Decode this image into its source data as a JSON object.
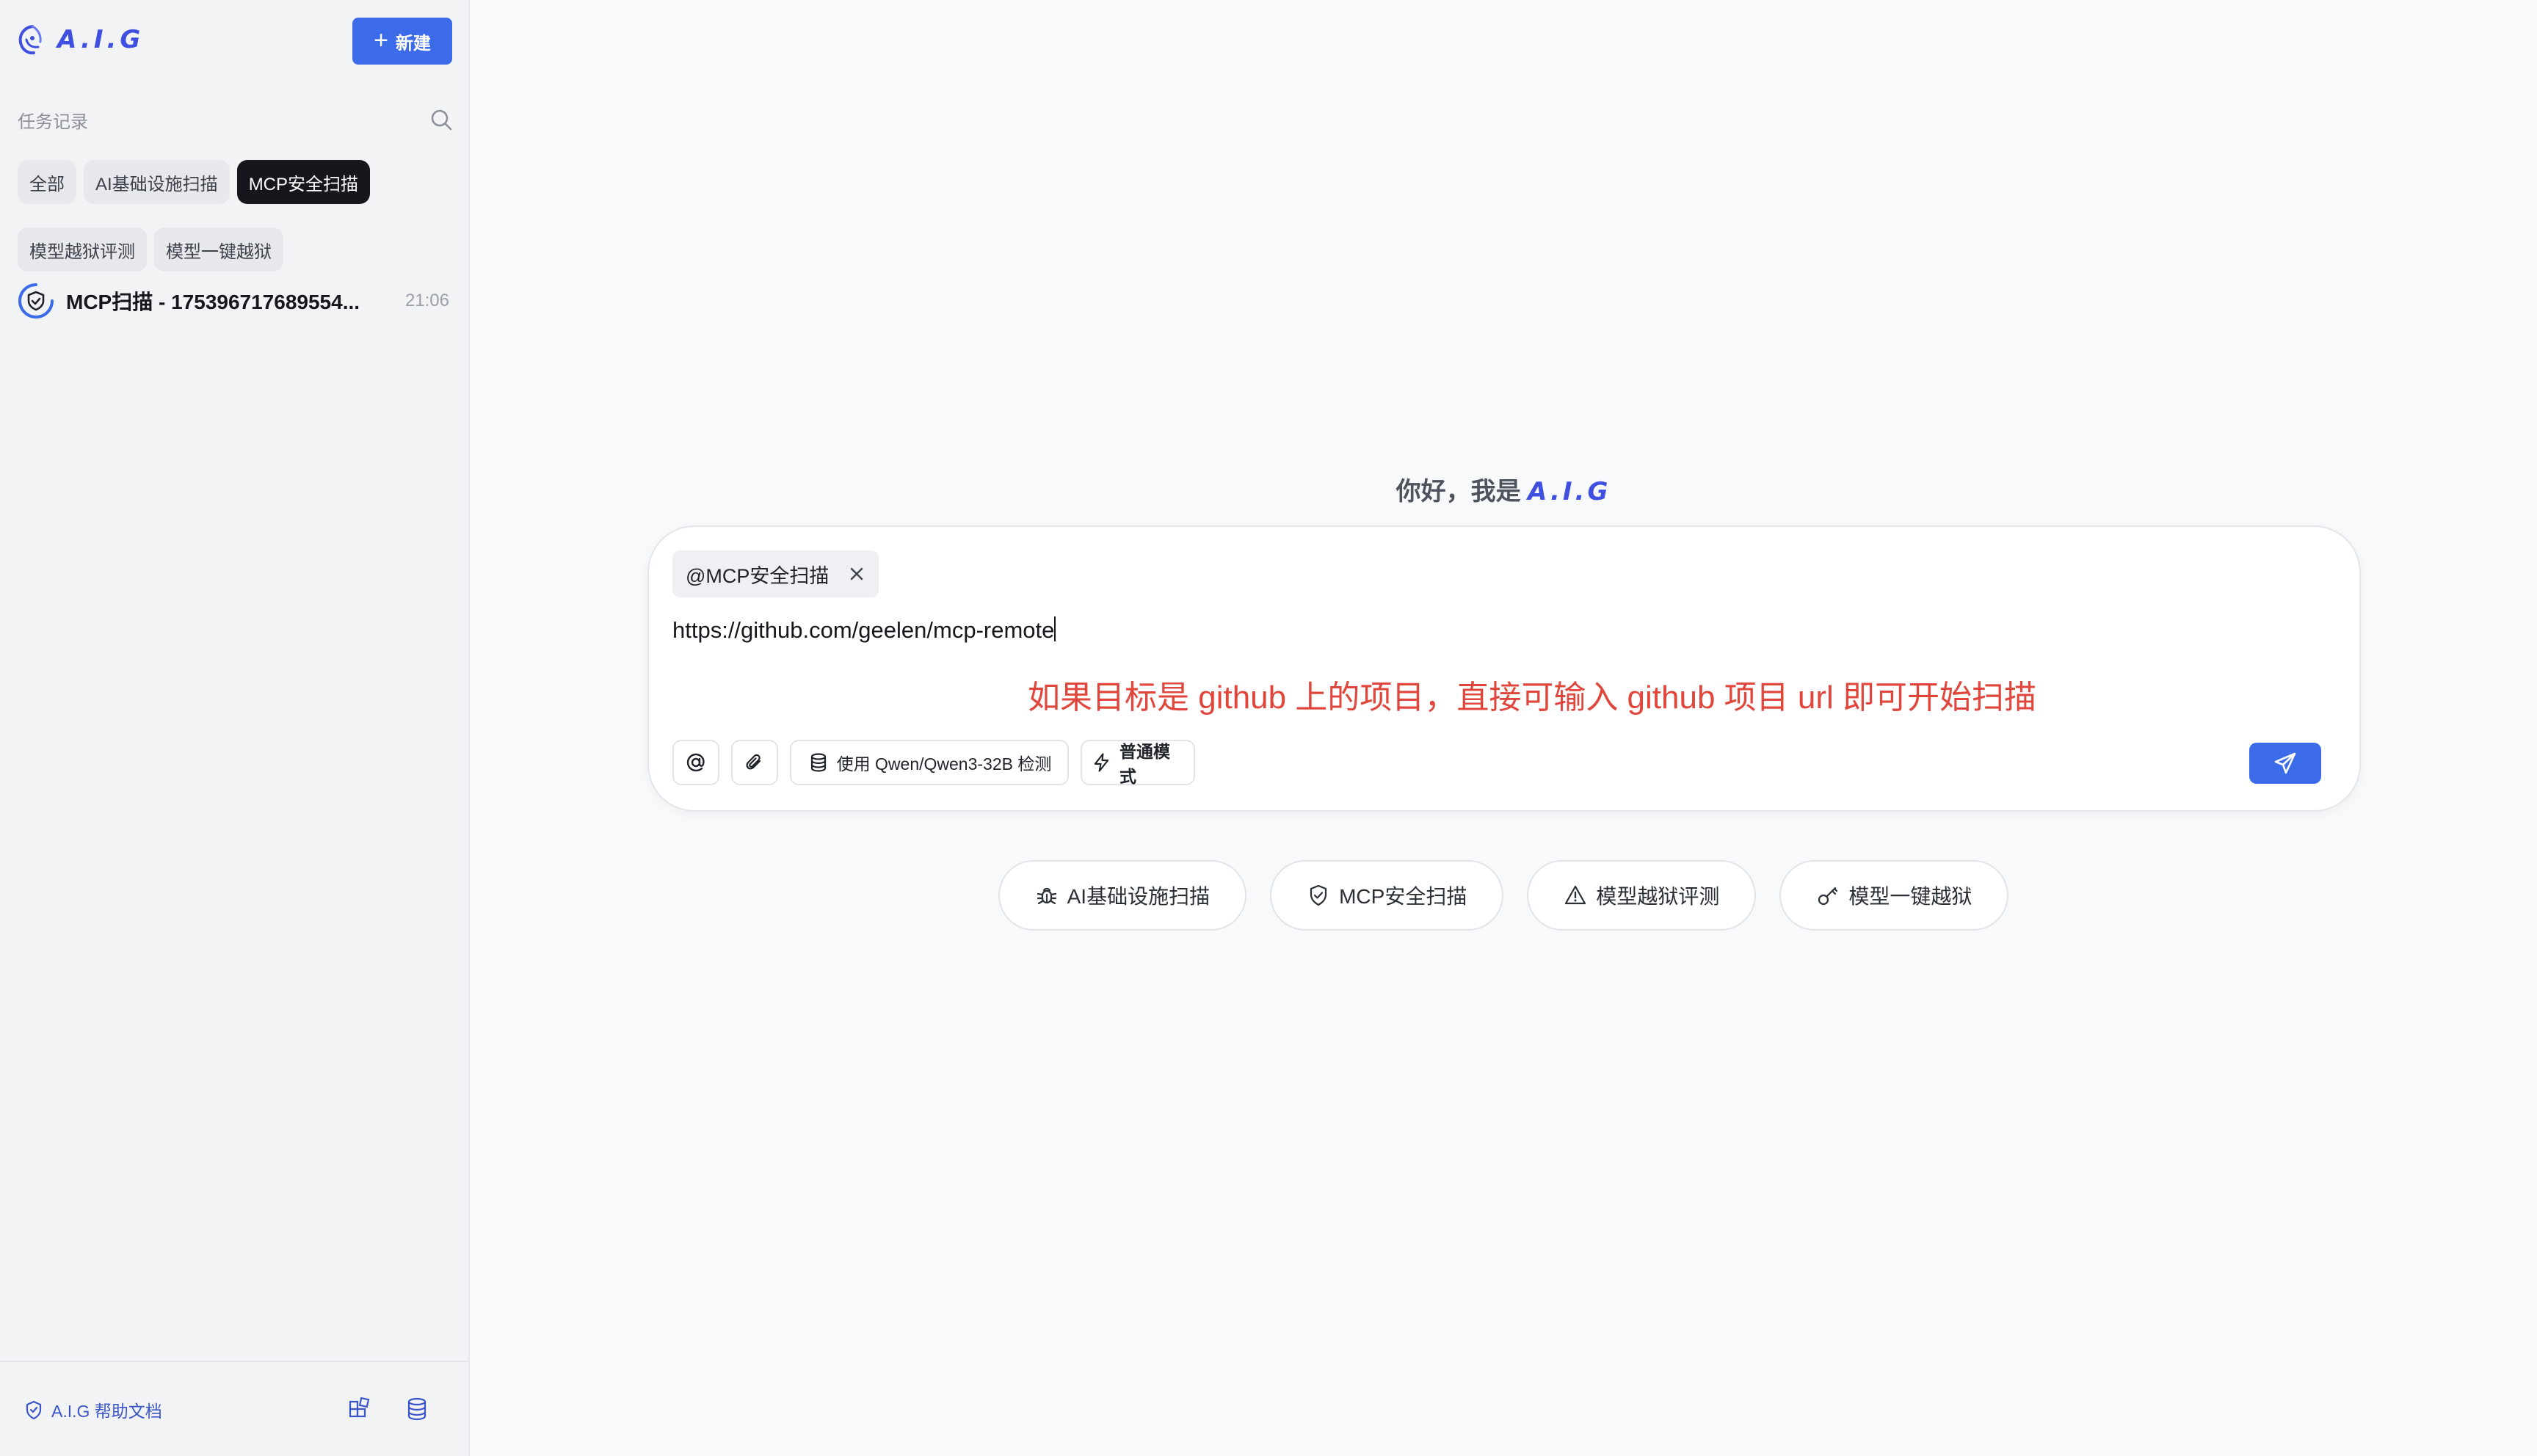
{
  "brand": {
    "name": "A.I.G"
  },
  "sidebar": {
    "new_button": "新建",
    "section_label": "任务记录",
    "filters": [
      "全部",
      "AI基础设施扫描",
      "MCP安全扫描",
      "模型越狱评测",
      "模型一键越狱"
    ],
    "active_filter": "MCP安全扫描",
    "tasks": [
      {
        "title": "MCP扫描 - 175396717689554...",
        "time": "21:06",
        "icon": "shield-check-icon"
      }
    ],
    "footer": {
      "help_link": "A.I.G 帮助文档"
    }
  },
  "main": {
    "greeting_prefix": "你好，我是",
    "greeting_brand": "A.I.G",
    "composer": {
      "mention_tag": "@MCP安全扫描",
      "input_value": "https://github.com/geelen/mcp-remote",
      "hint": "如果目标是 github 上的项目，直接可输入 github 项目 url 即可开始扫描",
      "model_button": "使用 Qwen/Qwen3-32B 检测",
      "mode_button": "普通模式"
    },
    "quick_actions": [
      {
        "label": "AI基础设施扫描",
        "icon": "bug-icon"
      },
      {
        "label": "MCP安全扫描",
        "icon": "shield-icon"
      },
      {
        "label": "模型越狱评测",
        "icon": "warning-icon"
      },
      {
        "label": "模型一键越狱",
        "icon": "key-icon"
      }
    ]
  },
  "colors": {
    "accent": "#3b6be8",
    "brand": "#3f4fe0",
    "hint": "#e0463b",
    "active_chip": "#15171c"
  }
}
